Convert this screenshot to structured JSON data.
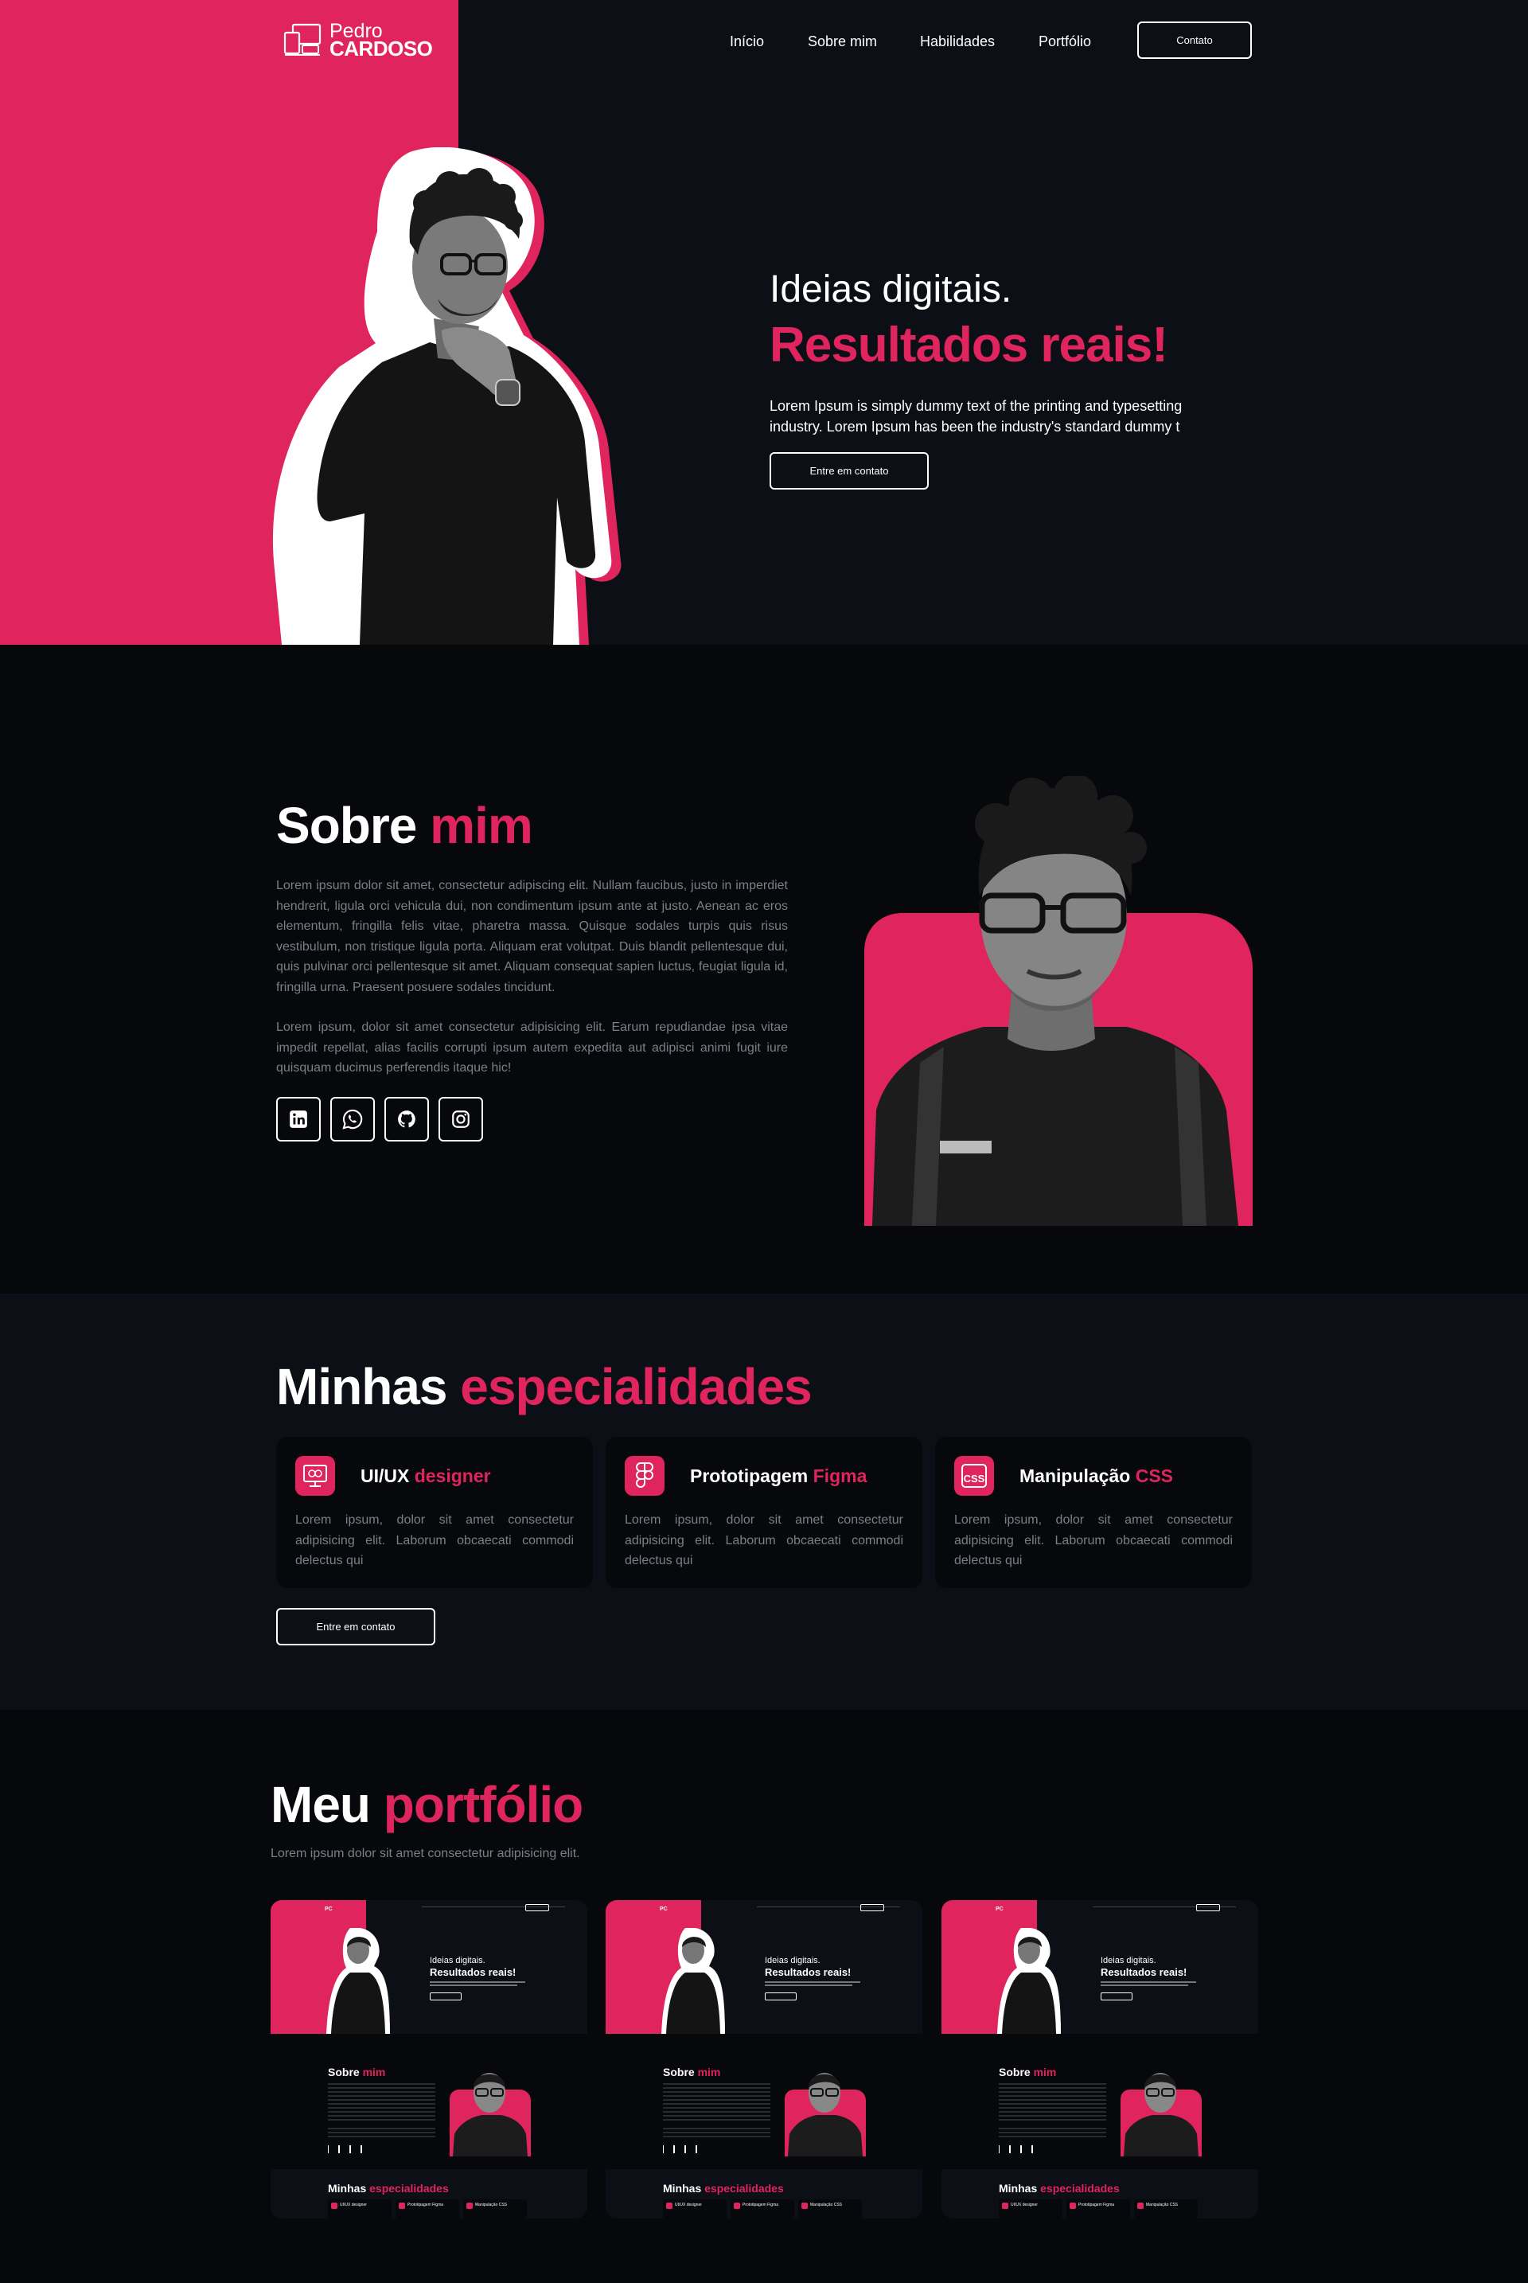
{
  "brand": {
    "first": "Pedro",
    "last": "CARDOSO"
  },
  "nav": {
    "items": [
      "Início",
      "Sobre mim",
      "Habilidades",
      "Portfólio"
    ],
    "contact": "Contato"
  },
  "hero": {
    "title_light": "Ideias digitais.",
    "title_bold": "Resultados reais!",
    "description": "Lorem Ipsum is simply dummy text of the printing and typesetting industry. Lorem Ipsum has been the industry's standard dummy t",
    "cta": "Entre em contato"
  },
  "about": {
    "title_white": "Sobre",
    "title_pink": "mim",
    "para1": "Lorem ipsum dolor sit amet, consectetur adipiscing elit. Nullam faucibus, justo in imperdiet hendrerit, ligula orci vehicula dui, non condimentum ipsum ante at justo. Aenean ac eros elementum, fringilla felis vitae, pharetra massa. Quisque sodales turpis quis risus vestibulum, non tristique ligula porta. Aliquam erat volutpat. Duis blandit pellentesque dui, quis pulvinar orci pellentesque sit amet. Aliquam consequat sapien luctus, feugiat ligula id, fringilla urna. Praesent posuere sodales tincidunt.",
    "para2": "Lorem ipsum, dolor sit amet consectetur adipisicing elit. Earum repudiandae ipsa vitae impedit repellat, alias facilis corrupti ipsum autem expedita aut adipisci animi fugit iure quisquam ducimus perferendis itaque hic!",
    "social_icons": [
      "linkedin-icon",
      "whatsapp-icon",
      "github-icon",
      "instagram-icon"
    ]
  },
  "specialties": {
    "title_white": "Minhas",
    "title_pink": "especialidades",
    "cards": [
      {
        "title_white": "UI/UX",
        "title_pink": "designer",
        "icon": "monitor-design-icon",
        "text": "Lorem ipsum, dolor sit amet consectetur adipisicing elit. Laborum obcaecati commodi delectus qui"
      },
      {
        "title_white": "Prototipagem",
        "title_pink": "Figma",
        "icon": "figma-icon",
        "text": "Lorem ipsum, dolor sit amet consectetur adipisicing elit. Laborum obcaecati commodi delectus qui"
      },
      {
        "title_white": "Manipulação",
        "title_pink": "CSS",
        "icon": "css-icon",
        "text": "Lorem ipsum, dolor sit amet consectetur adipisicing elit. Laborum obcaecati commodi delectus qui"
      }
    ],
    "cta": "Entre em contato"
  },
  "portfolio": {
    "title_white": "Meu",
    "title_pink": "portfólio",
    "subtitle": "Lorem ipsum dolor sit amet consectetur adipisicing elit.",
    "thumb": {
      "hero_light": "Ideias digitais.",
      "hero_bold": "Resultados reais!",
      "about_white": "Sobre",
      "about_pink": "mim",
      "spec_white": "Minhas",
      "spec_pink": "especialidades",
      "cards": [
        "UI/UX designer",
        "Prototipagem Figma",
        "Manipulação CSS"
      ]
    }
  },
  "colors": {
    "accent": "#e0245e",
    "bg_dark": "#07080c",
    "bg_panel": "#0c0f16",
    "muted_text": "#7d7f87"
  }
}
